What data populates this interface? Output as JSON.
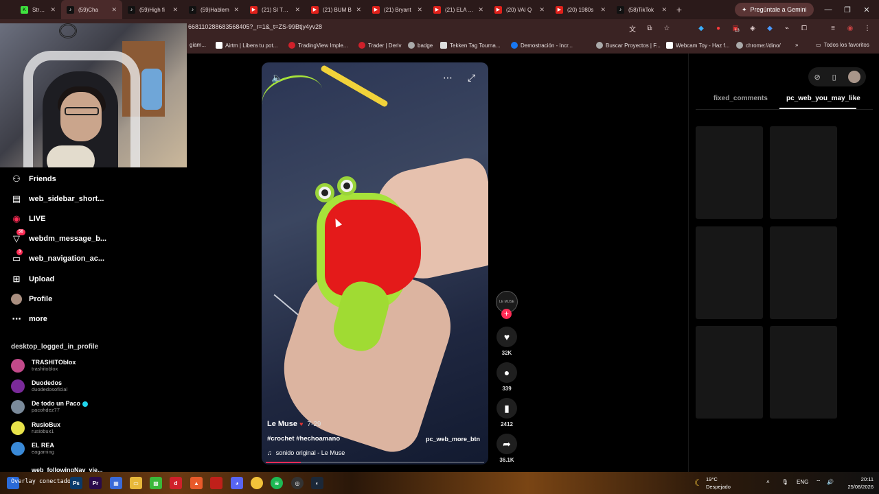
{
  "browser": {
    "tabs": [
      {
        "title": "Stream - Ki",
        "icon": "kick-icon"
      },
      {
        "title": "(59)Cha",
        "icon": "tiktok-icon",
        "active": true
      },
      {
        "title": "(59)High fi",
        "icon": "tiktok-icon"
      },
      {
        "title": "(59)Hablem",
        "icon": "tiktok-icon"
      },
      {
        "title": "(21) SI TE S",
        "icon": "youtube-icon"
      },
      {
        "title": "(21) BUM B",
        "icon": "youtube-icon"
      },
      {
        "title": "(21) Bryant",
        "icon": "youtube-icon"
      },
      {
        "title": "(21) ELA KE",
        "icon": "youtube-icon"
      },
      {
        "title": "(20) VAI Q",
        "icon": "youtube-icon"
      },
      {
        "title": "(20) 1980s",
        "icon": "youtube-icon"
      },
      {
        "title": "(58)TikTok",
        "icon": "tiktok-icon"
      }
    ],
    "new_tab": "+",
    "gemini": "Pregúntale a Gemini",
    "url": "668110288683568405?_r=1&_t=ZS-99Btjy4yv28",
    "bookmarks": [
      "giam...",
      "Airtm | Libera tu pot...",
      "TradingView Imple...",
      "Trader | Deriv",
      "badge",
      "Tekken Tag Tourna...",
      "Demostración - Incr...",
      "Buscar Proyectos | F...",
      "Webcam Toy - Haz f...",
      "chrome://dino/"
    ],
    "bookmarks_more": "»",
    "all_favorites": "Todos los favoritos",
    "ext_badge": "13"
  },
  "sidebar": {
    "items": [
      {
        "label": "Friends",
        "icon": "friends-icon"
      },
      {
        "label": "web_sidebar_short...",
        "icon": "shorts-icon"
      },
      {
        "label": "LIVE",
        "icon": "live-icon"
      },
      {
        "label": "webdm_message_b...",
        "icon": "message-icon",
        "badge": "56"
      },
      {
        "label": "web_navigation_ac...",
        "icon": "activity-icon",
        "badge": "3"
      },
      {
        "label": "Upload",
        "icon": "upload-icon"
      },
      {
        "label": "Profile",
        "icon": "profile-icon"
      },
      {
        "label": "more",
        "icon": "more-icon"
      }
    ],
    "section_title": "desktop_logged_in_profile",
    "following": [
      {
        "name": "TRASHITOblox",
        "handle": "trashitoblox",
        "color": "#c24a8a"
      },
      {
        "name": "Duodedos",
        "handle": "duodedosoficial",
        "color": "#7a2a9a"
      },
      {
        "name": "De todo un Paco",
        "handle": "pacohdez77",
        "color": "#7a8a9a",
        "verified": true
      },
      {
        "name": "RusioBux",
        "handle": "rusiobux1",
        "color": "#e8e34a"
      },
      {
        "name": "EL REA",
        "handle": "eagaming",
        "color": "#3a8ad8"
      }
    ],
    "following_nav": "web_followingNav_vie..."
  },
  "video": {
    "author": "Le Muse",
    "date": "7-29",
    "tags": "#crochet #hechoamano",
    "more_btn": "pc_web_more_btn",
    "music": "sonido original - Le Muse",
    "progress": 0.16,
    "creator_avatar_text": "LE MUSE"
  },
  "actions": {
    "likes": "32K",
    "comments": "339",
    "saves": "2412",
    "shares": "36.1K"
  },
  "right_panel": {
    "tab_comments": "fixed_comments",
    "tab_like": "pc_web_you_may_like"
  },
  "taskbar": {
    "overlay": "Overlay conectado.",
    "temp": "19°C",
    "weather": "Despejado",
    "lang": "ENG",
    "time": "20:11",
    "date": "25/08/2026"
  }
}
